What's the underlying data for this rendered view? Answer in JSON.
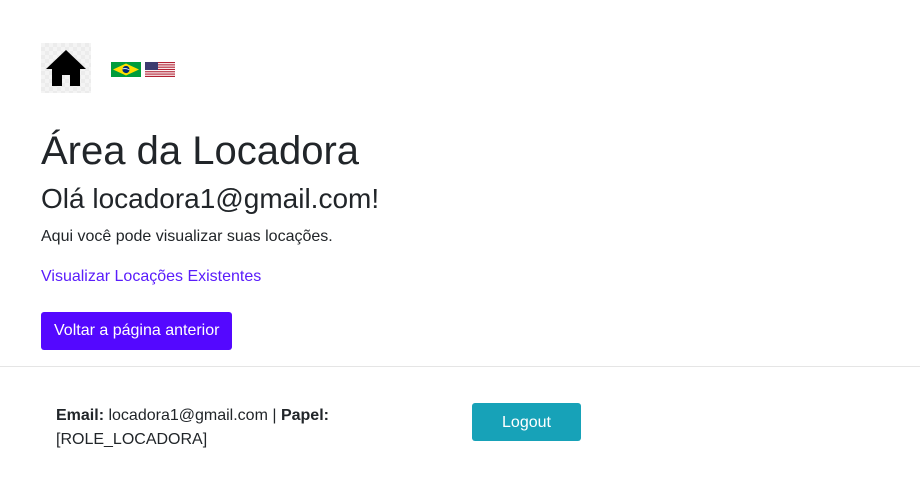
{
  "header": {
    "home_icon": "home-icon",
    "languages": [
      {
        "code": "pt-BR",
        "icon": "brazil-flag-icon"
      },
      {
        "code": "en-US",
        "icon": "us-flag-icon"
      }
    ]
  },
  "main": {
    "title": "Área da Locadora",
    "greeting": "Olá locadora1@gmail.com!",
    "description": "Aqui você pode visualizar suas locações.",
    "view_rentals_link": "Visualizar Locações Existentes",
    "back_button": "Voltar a página anterior"
  },
  "footer": {
    "email_label": "Email:",
    "email_value": "locadora1@gmail.com",
    "separator": "|",
    "role_label": "Papel:",
    "role_value": "[ROLE_LOCADORA]",
    "logout_button": "Logout"
  },
  "colors": {
    "link": "#5a1dfb",
    "primary_button": "#5408ff",
    "logout_button": "#17a2b8"
  }
}
